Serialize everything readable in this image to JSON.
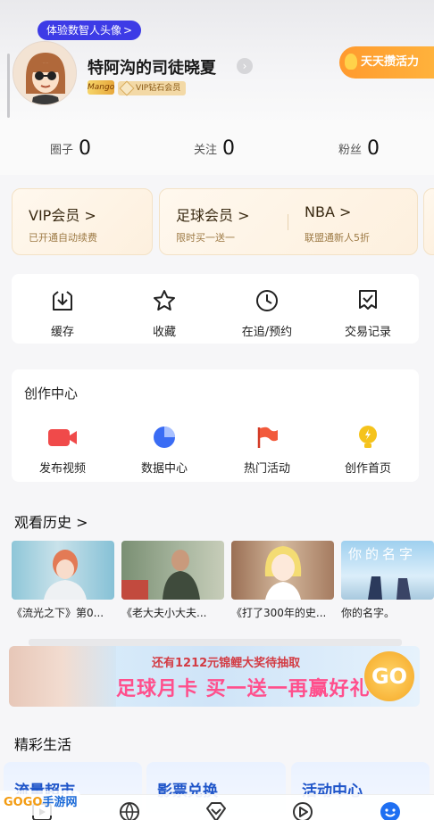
{
  "header": {
    "digital_avatar_bubble": "体验数智人头像",
    "bubble_arrow": ">",
    "username": "特阿沟的司徒晓夏",
    "medal_badge": "Mango",
    "vip_badge": "VIP钻石会员",
    "energy_button": "天天攒活力"
  },
  "stats": [
    {
      "label": "圈子",
      "value": "0"
    },
    {
      "label": "关注",
      "value": "0"
    },
    {
      "label": "粉丝",
      "value": "0"
    }
  ],
  "memberships": [
    {
      "title": "VIP会员",
      "subtitle": "已开通自动续费"
    },
    {
      "title": "足球会员",
      "subtitle": "限时买一送一"
    },
    {
      "title": "NBA",
      "subtitle": "联盟通新人5折"
    }
  ],
  "chevron": ">",
  "tools": [
    {
      "label": "缓存",
      "icon": "download-box-icon"
    },
    {
      "label": "收藏",
      "icon": "star-icon"
    },
    {
      "label": "在追/预约",
      "icon": "clock-icon"
    },
    {
      "label": "交易记录",
      "icon": "receipt-check-icon"
    }
  ],
  "creation": {
    "title": "创作中心",
    "items": [
      {
        "label": "发布视频",
        "icon": "video-camera-icon",
        "color": "#f04a4a"
      },
      {
        "label": "数据中心",
        "icon": "pie-chart-icon",
        "color": "#3a6cf4"
      },
      {
        "label": "热门活动",
        "icon": "flag-icon",
        "color": "#f25a3c"
      },
      {
        "label": "创作首页",
        "icon": "lightbulb-icon",
        "color": "#f5c31c"
      }
    ]
  },
  "history": {
    "title": "观看历史 >",
    "items": [
      {
        "caption": "《流光之下》第0..."
      },
      {
        "caption": "《老大夫小大夫..."
      },
      {
        "caption": "《打了300年的史..."
      },
      {
        "caption": "你的名字。",
        "thumb_text": "你的名字"
      }
    ]
  },
  "banner": {
    "top_line": "还有1212元锦鲤大奖待抽取",
    "main_line": "足球月卡 买一送一再赢好礼",
    "go_label": "GO"
  },
  "life": {
    "title": "精彩生活",
    "cards": [
      {
        "title": "流量超市"
      },
      {
        "title": "影票兑换"
      },
      {
        "title": "活动中心"
      }
    ]
  },
  "watermark": {
    "brand": "GOGO",
    "suffix": "手游网"
  },
  "colors": {
    "accent_blue": "#3d3be6",
    "energy_orange": "#ffa530",
    "gold_text": "#9d7a45",
    "active_tab": "#1e6ff2"
  }
}
